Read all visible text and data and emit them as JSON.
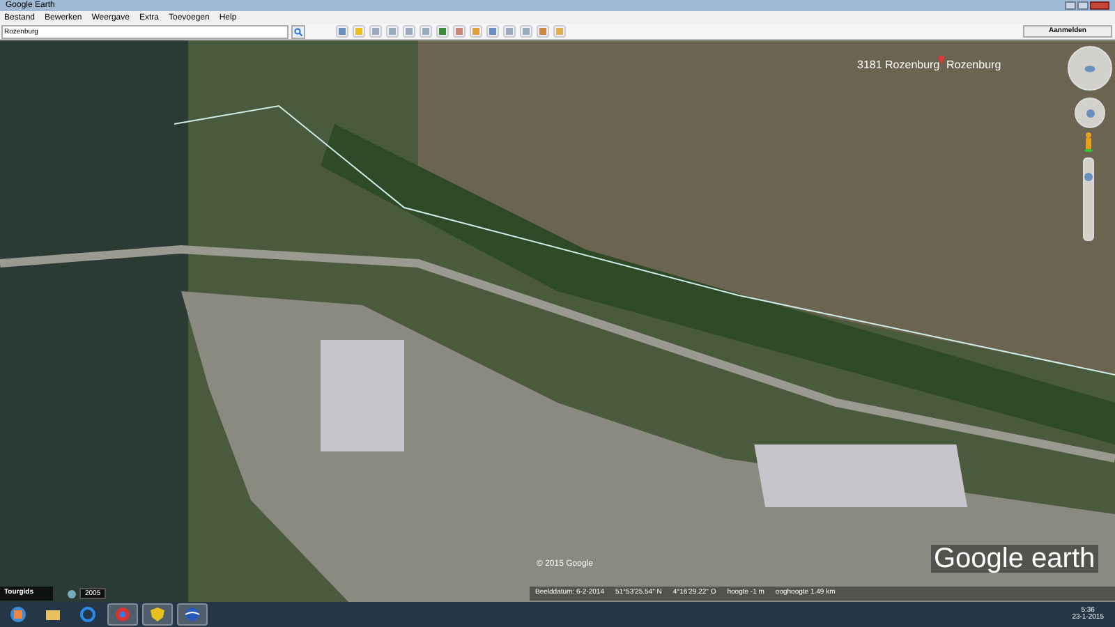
{
  "window": {
    "title": "Google Earth"
  },
  "menu": [
    "Bestand",
    "Bewerken",
    "Weergave",
    "Extra",
    "Toevoegen",
    "Help"
  ],
  "search": {
    "value": "Rozenburg"
  },
  "signin_button": "Aanmelden",
  "zoom_slider": {
    "level": 0.8
  },
  "map": {
    "labels": [
      {
        "text": "3181 Rozenburg"
      },
      {
        "text": "Rozenburg"
      }
    ],
    "copyright": "© 2015 Google",
    "logo": "Google earth",
    "tour_guide": "Tourgids",
    "historical_year": "2005",
    "status": [
      "Beelddatum: 6-2-2014",
      "51°53'25.54\" N",
      "4°16'29.22\" O",
      "hoogte -1 m",
      "ooghoogte 1.49 km"
    ]
  },
  "taskbar": {
    "apps": [
      {
        "kind": "start",
        "selected": false
      },
      {
        "kind": "folder",
        "selected": false
      },
      {
        "kind": "browser-e",
        "selected": false
      },
      {
        "kind": "chrome",
        "selected": true
      },
      {
        "kind": "shield",
        "selected": true
      },
      {
        "kind": "earth",
        "selected": true
      }
    ],
    "time": "5:36",
    "date": "23-1-2015"
  }
}
